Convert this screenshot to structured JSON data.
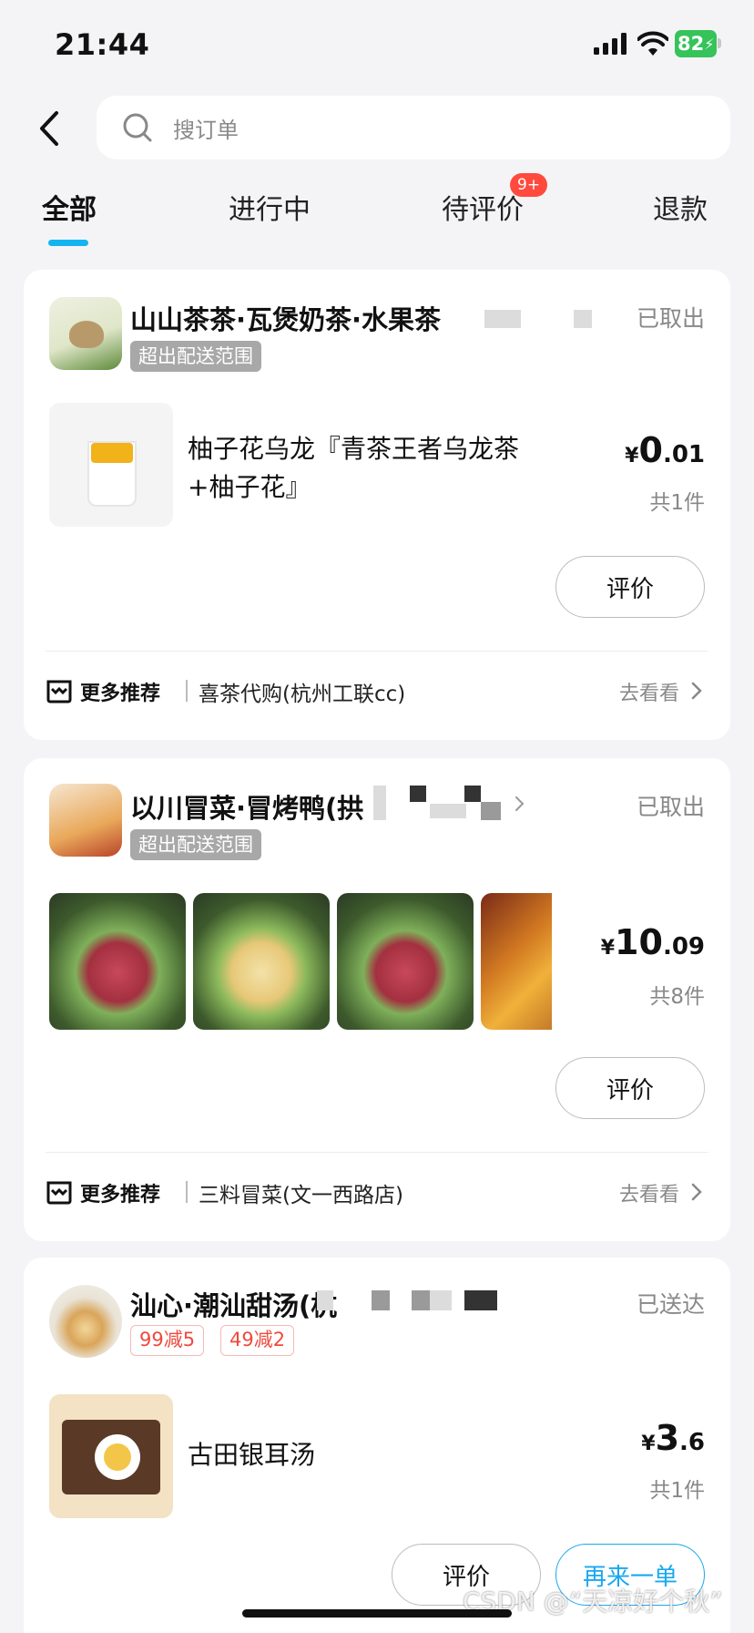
{
  "status_bar": {
    "time": "21:44",
    "battery": "82"
  },
  "search": {
    "placeholder": "搜订单"
  },
  "tabs": [
    {
      "label": "全部",
      "active": true
    },
    {
      "label": "进行中",
      "active": false
    },
    {
      "label": "待评价",
      "active": false,
      "badge": "9+"
    },
    {
      "label": "退款",
      "active": false
    }
  ],
  "orders": [
    {
      "shop": "山山茶茶·瓦煲奶茶·水果茶",
      "status": "已取出",
      "tags": [
        "超出配送范围"
      ],
      "item_name": "柚子花乌龙『青茶王者乌龙茶+柚子花』",
      "price_yen": "¥",
      "price_int": "0",
      "price_dec": ".01",
      "count": "共1件",
      "buttons": [
        "评价"
      ],
      "rec_label": "更多推荐",
      "rec_shop": "喜茶代购(杭州工联cc)",
      "rec_go": "去看看"
    },
    {
      "shop": "以川冒菜·冒烤鸭(拱",
      "status": "已取出",
      "tags": [
        "超出配送范围"
      ],
      "price_yen": "¥",
      "price_int": "10",
      "price_dec": ".09",
      "count": "共8件",
      "buttons": [
        "评价"
      ],
      "rec_label": "更多推荐",
      "rec_shop": "三料冒菜(文一西路店)",
      "rec_go": "去看看"
    },
    {
      "shop": "汕心·潮汕甜汤(杭",
      "status": "已送达",
      "promos": [
        "99减5",
        "49减2"
      ],
      "item_name": "古田银耳汤",
      "price_yen": "¥",
      "price_int": "3",
      "price_dec": ".6",
      "count": "共1件",
      "buttons": [
        "评价",
        "再来一单"
      ]
    }
  ],
  "watermark": "CSDN @“天凉好个秋”",
  "colors": {
    "accent": "#14b4f0",
    "badge": "#ff4a3d",
    "promo_red": "#ef4a3d"
  }
}
